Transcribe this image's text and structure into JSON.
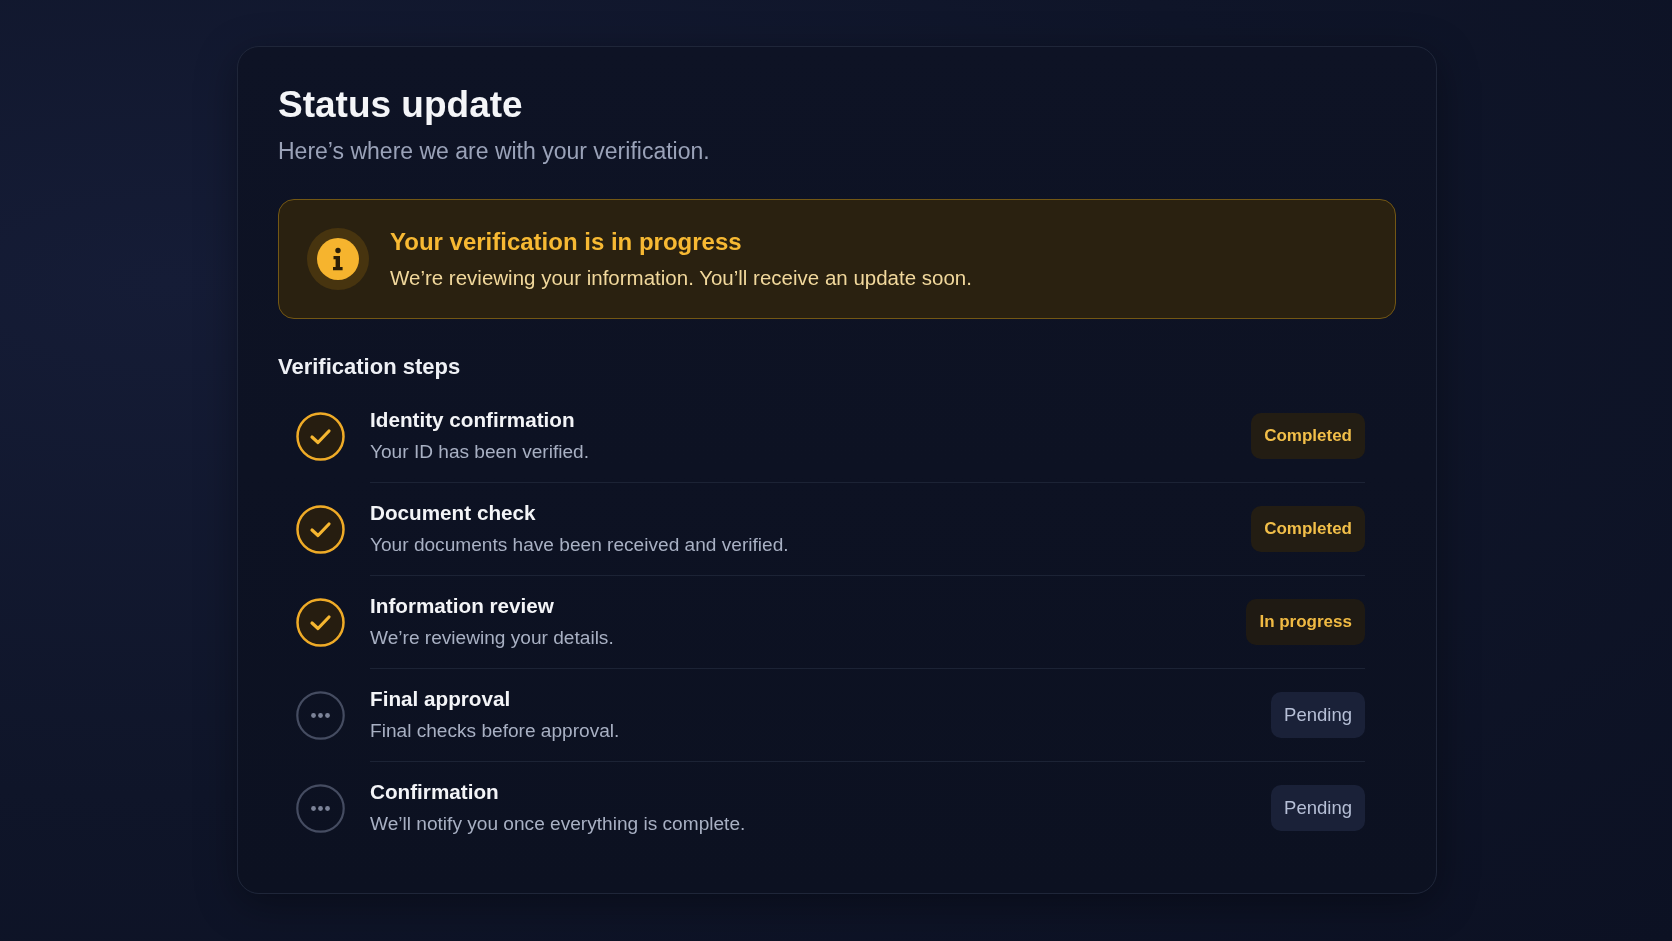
{
  "header": {
    "title": "Status update",
    "subtitle": "Here’s where we are with your verification."
  },
  "alert": {
    "title": "Your verification is in progress",
    "message": "We’re reviewing your information. You’ll receive an update soon."
  },
  "steps_section": {
    "heading": "Verification steps",
    "steps": [
      {
        "title": "Identity confirmation",
        "description": "Your ID has been verified.",
        "checked": true,
        "kind": "done",
        "badge": "Completed"
      },
      {
        "title": "Document check",
        "description": "Your documents have been received and verified.",
        "checked": true,
        "kind": "done",
        "badge": "Completed"
      },
      {
        "title": "Information review",
        "description": "We’re reviewing your details.",
        "checked": true,
        "kind": "active",
        "badge": "In progress"
      },
      {
        "title": "Final approval",
        "description": "Final checks before approval.",
        "checked": false,
        "kind": "pending",
        "badge": "Pending"
      },
      {
        "title": "Confirmation",
        "description": "We’ll notify you once everything is complete.",
        "checked": false,
        "kind": "pending",
        "badge": "Pending"
      }
    ]
  }
}
